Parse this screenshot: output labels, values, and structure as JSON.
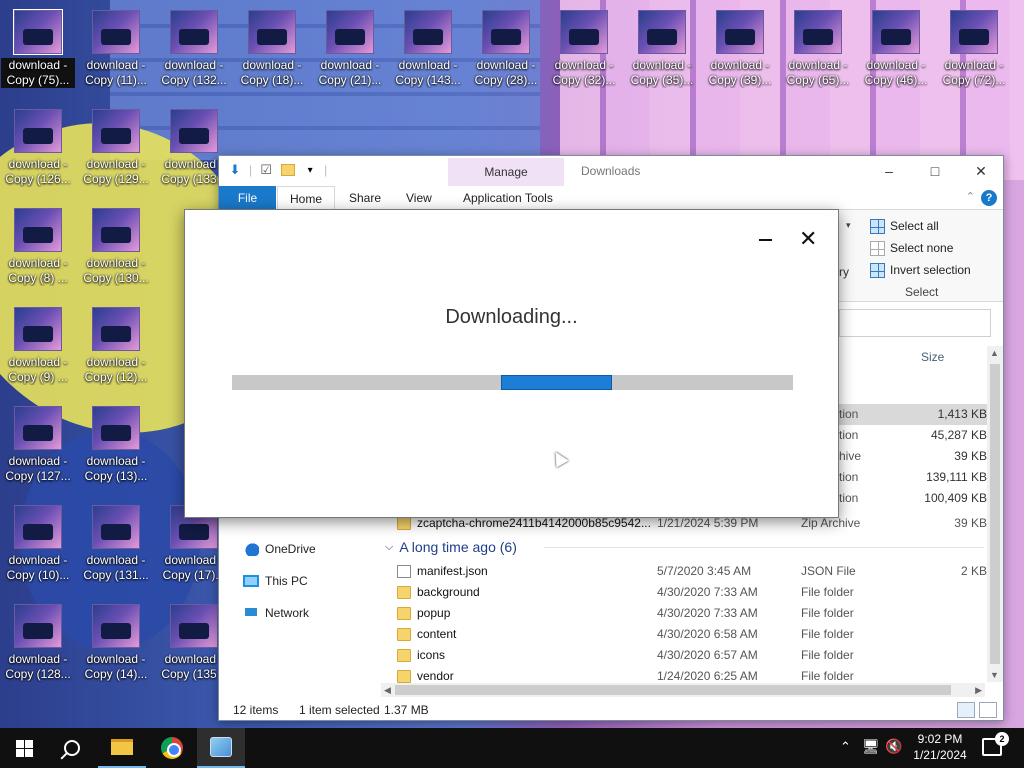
{
  "desktop": {
    "icons_row1": [
      "download - Copy (75)...",
      "download - Copy (11)...",
      "download - Copy (132...",
      "download - Copy (18)...",
      "download - Copy (21)...",
      "download - Copy (143...",
      "download - Copy (28)...",
      "download - Copy (32)...",
      "download - Copy (35)...",
      "download - Copy (39)...",
      "download - Copy (65)...",
      "download - Copy (46)...",
      "download - Copy (72)..."
    ],
    "icons_col": [
      [
        "download - Copy (126...",
        "download - Copy (129...",
        "download - Copy (133..."
      ],
      [
        "download - Copy (8) ...",
        "download - Copy (130..."
      ],
      [
        "download - Copy (9) ...",
        "download - Copy (12)..."
      ],
      [
        "download - Copy (127...",
        "download - Copy (13)..."
      ],
      [
        "download - Copy (10)...",
        "download - Copy (131...",
        "download - Copy (17)..."
      ],
      [
        "download - Copy (128...",
        "download - Copy (14)...",
        "download - Copy (135..."
      ]
    ]
  },
  "explorer": {
    "title": "Downloads",
    "manage_tab": "Manage",
    "tabs": {
      "file": "File",
      "home": "Home",
      "share": "Share",
      "view": "View",
      "app_tools": "Application Tools"
    },
    "ribbon": {
      "select_all": "Select all",
      "select_none": "Select none",
      "invert_selection": "Invert selection",
      "select_group": "Select",
      "partial_label": "ry"
    },
    "columns": {
      "size": "Size"
    },
    "top_rows": [
      {
        "type": "tion",
        "size": "1,413 KB"
      },
      {
        "type": "tion",
        "size": "45,287 KB"
      },
      {
        "type": "hive",
        "size": "39 KB"
      },
      {
        "type": "tion",
        "size": "139,111 KB"
      },
      {
        "type": "tion",
        "size": "100,409 KB"
      }
    ],
    "partial_row": {
      "name": "zcaptcha-chrome2411b4142000b85c9542...",
      "date": "1/21/2024 5:39 PM",
      "type": "Zip Archive",
      "size": "39 KB"
    },
    "nav": {
      "onedrive": "OneDrive",
      "this_pc": "This PC",
      "network": "Network"
    },
    "group_header": "A long time ago (6)",
    "files": [
      {
        "name": "manifest.json",
        "date": "5/7/2020 3:45 AM",
        "type": "JSON File",
        "size": "2 KB",
        "icon": "json-file-icon"
      },
      {
        "name": "background",
        "date": "4/30/2020 7:33 AM",
        "type": "File folder",
        "size": "",
        "icon": "folder-icon"
      },
      {
        "name": "popup",
        "date": "4/30/2020 7:33 AM",
        "type": "File folder",
        "size": "",
        "icon": "folder-icon"
      },
      {
        "name": "content",
        "date": "4/30/2020 6:58 AM",
        "type": "File folder",
        "size": "",
        "icon": "folder-icon"
      },
      {
        "name": "icons",
        "date": "4/30/2020 6:57 AM",
        "type": "File folder",
        "size": "",
        "icon": "folder-icon"
      },
      {
        "name": "vendor",
        "date": "1/24/2020 6:25 AM",
        "type": "File folder",
        "size": "",
        "icon": "folder-icon"
      }
    ],
    "status": {
      "items": "12 items",
      "selected": "1 item selected",
      "size": "1.37 MB"
    }
  },
  "dialog": {
    "message": "Downloading...",
    "progress_position": 0.48
  },
  "taskbar": {
    "time": "9:02 PM",
    "date": "1/21/2024",
    "notification_count": "2"
  }
}
